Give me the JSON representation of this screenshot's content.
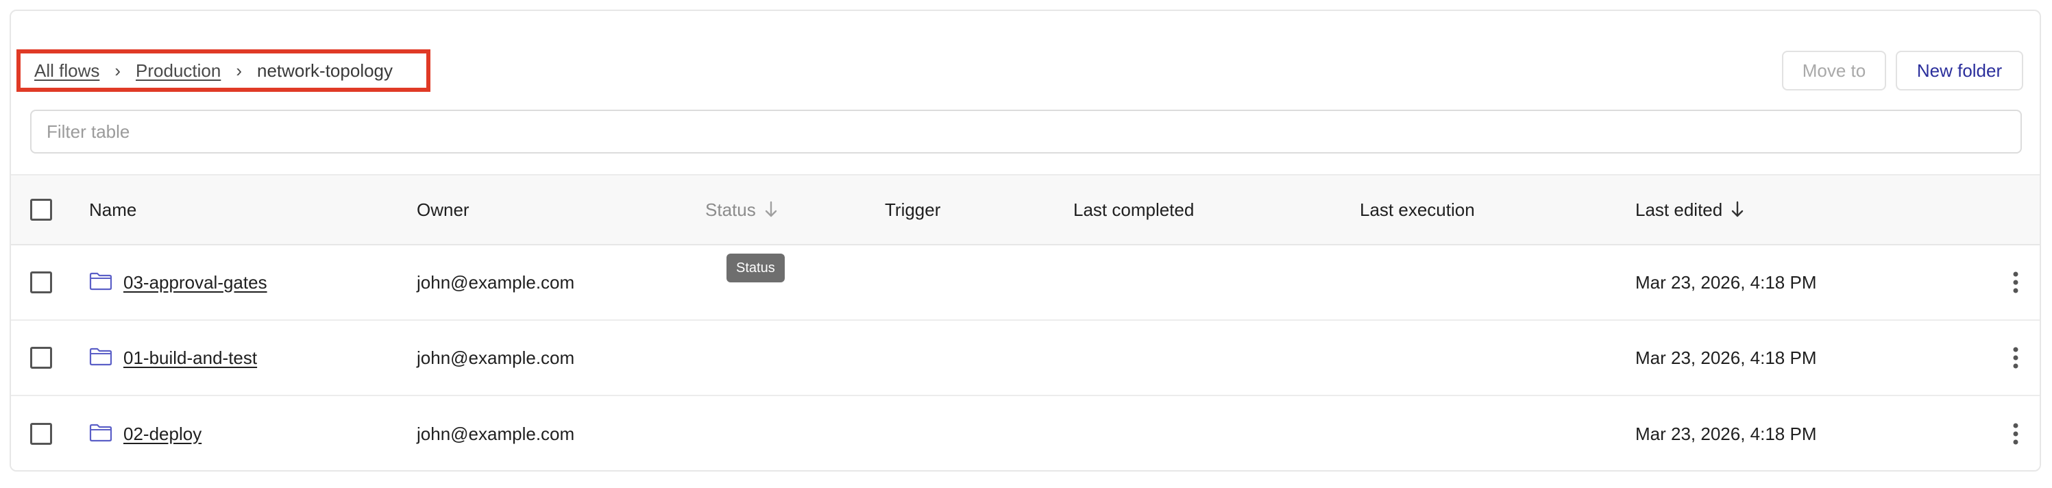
{
  "breadcrumb": {
    "items": [
      {
        "label": "All flows"
      },
      {
        "label": "Production"
      }
    ],
    "separator": "›",
    "current": "network-topology"
  },
  "actions": {
    "move_to_label": "Move to",
    "new_folder_label": "New folder"
  },
  "filter": {
    "placeholder": "Filter table",
    "value": ""
  },
  "table": {
    "columns": {
      "name": "Name",
      "owner": "Owner",
      "status": "Status",
      "trigger": "Trigger",
      "last_completed": "Last completed",
      "last_execution": "Last execution",
      "last_edited": "Last edited"
    },
    "rows": [
      {
        "name": "03-approval-gates",
        "owner": "john@example.com",
        "status": "",
        "trigger": "",
        "last_completed": "",
        "last_execution": "",
        "last_edited": "Mar 23, 2026, 4:18 PM"
      },
      {
        "name": "01-build-and-test",
        "owner": "john@example.com",
        "status": "",
        "trigger": "",
        "last_completed": "",
        "last_execution": "",
        "last_edited": "Mar 23, 2026, 4:18 PM"
      },
      {
        "name": "02-deploy",
        "owner": "john@example.com",
        "status": "",
        "trigger": "",
        "last_completed": "",
        "last_execution": "",
        "last_edited": "Mar 23, 2026, 4:18 PM"
      }
    ]
  },
  "tooltip": {
    "text": "Status"
  },
  "colors": {
    "highlight_border": "#e03a26",
    "primary_text": "#2b2f9c",
    "folder_icon": "#5b5fc7",
    "tooltip_bg": "#6e6e6e"
  },
  "icons": {
    "sort": "arrow-down-icon",
    "folder": "folder-icon",
    "row_menu": "kebab-menu-icon"
  }
}
